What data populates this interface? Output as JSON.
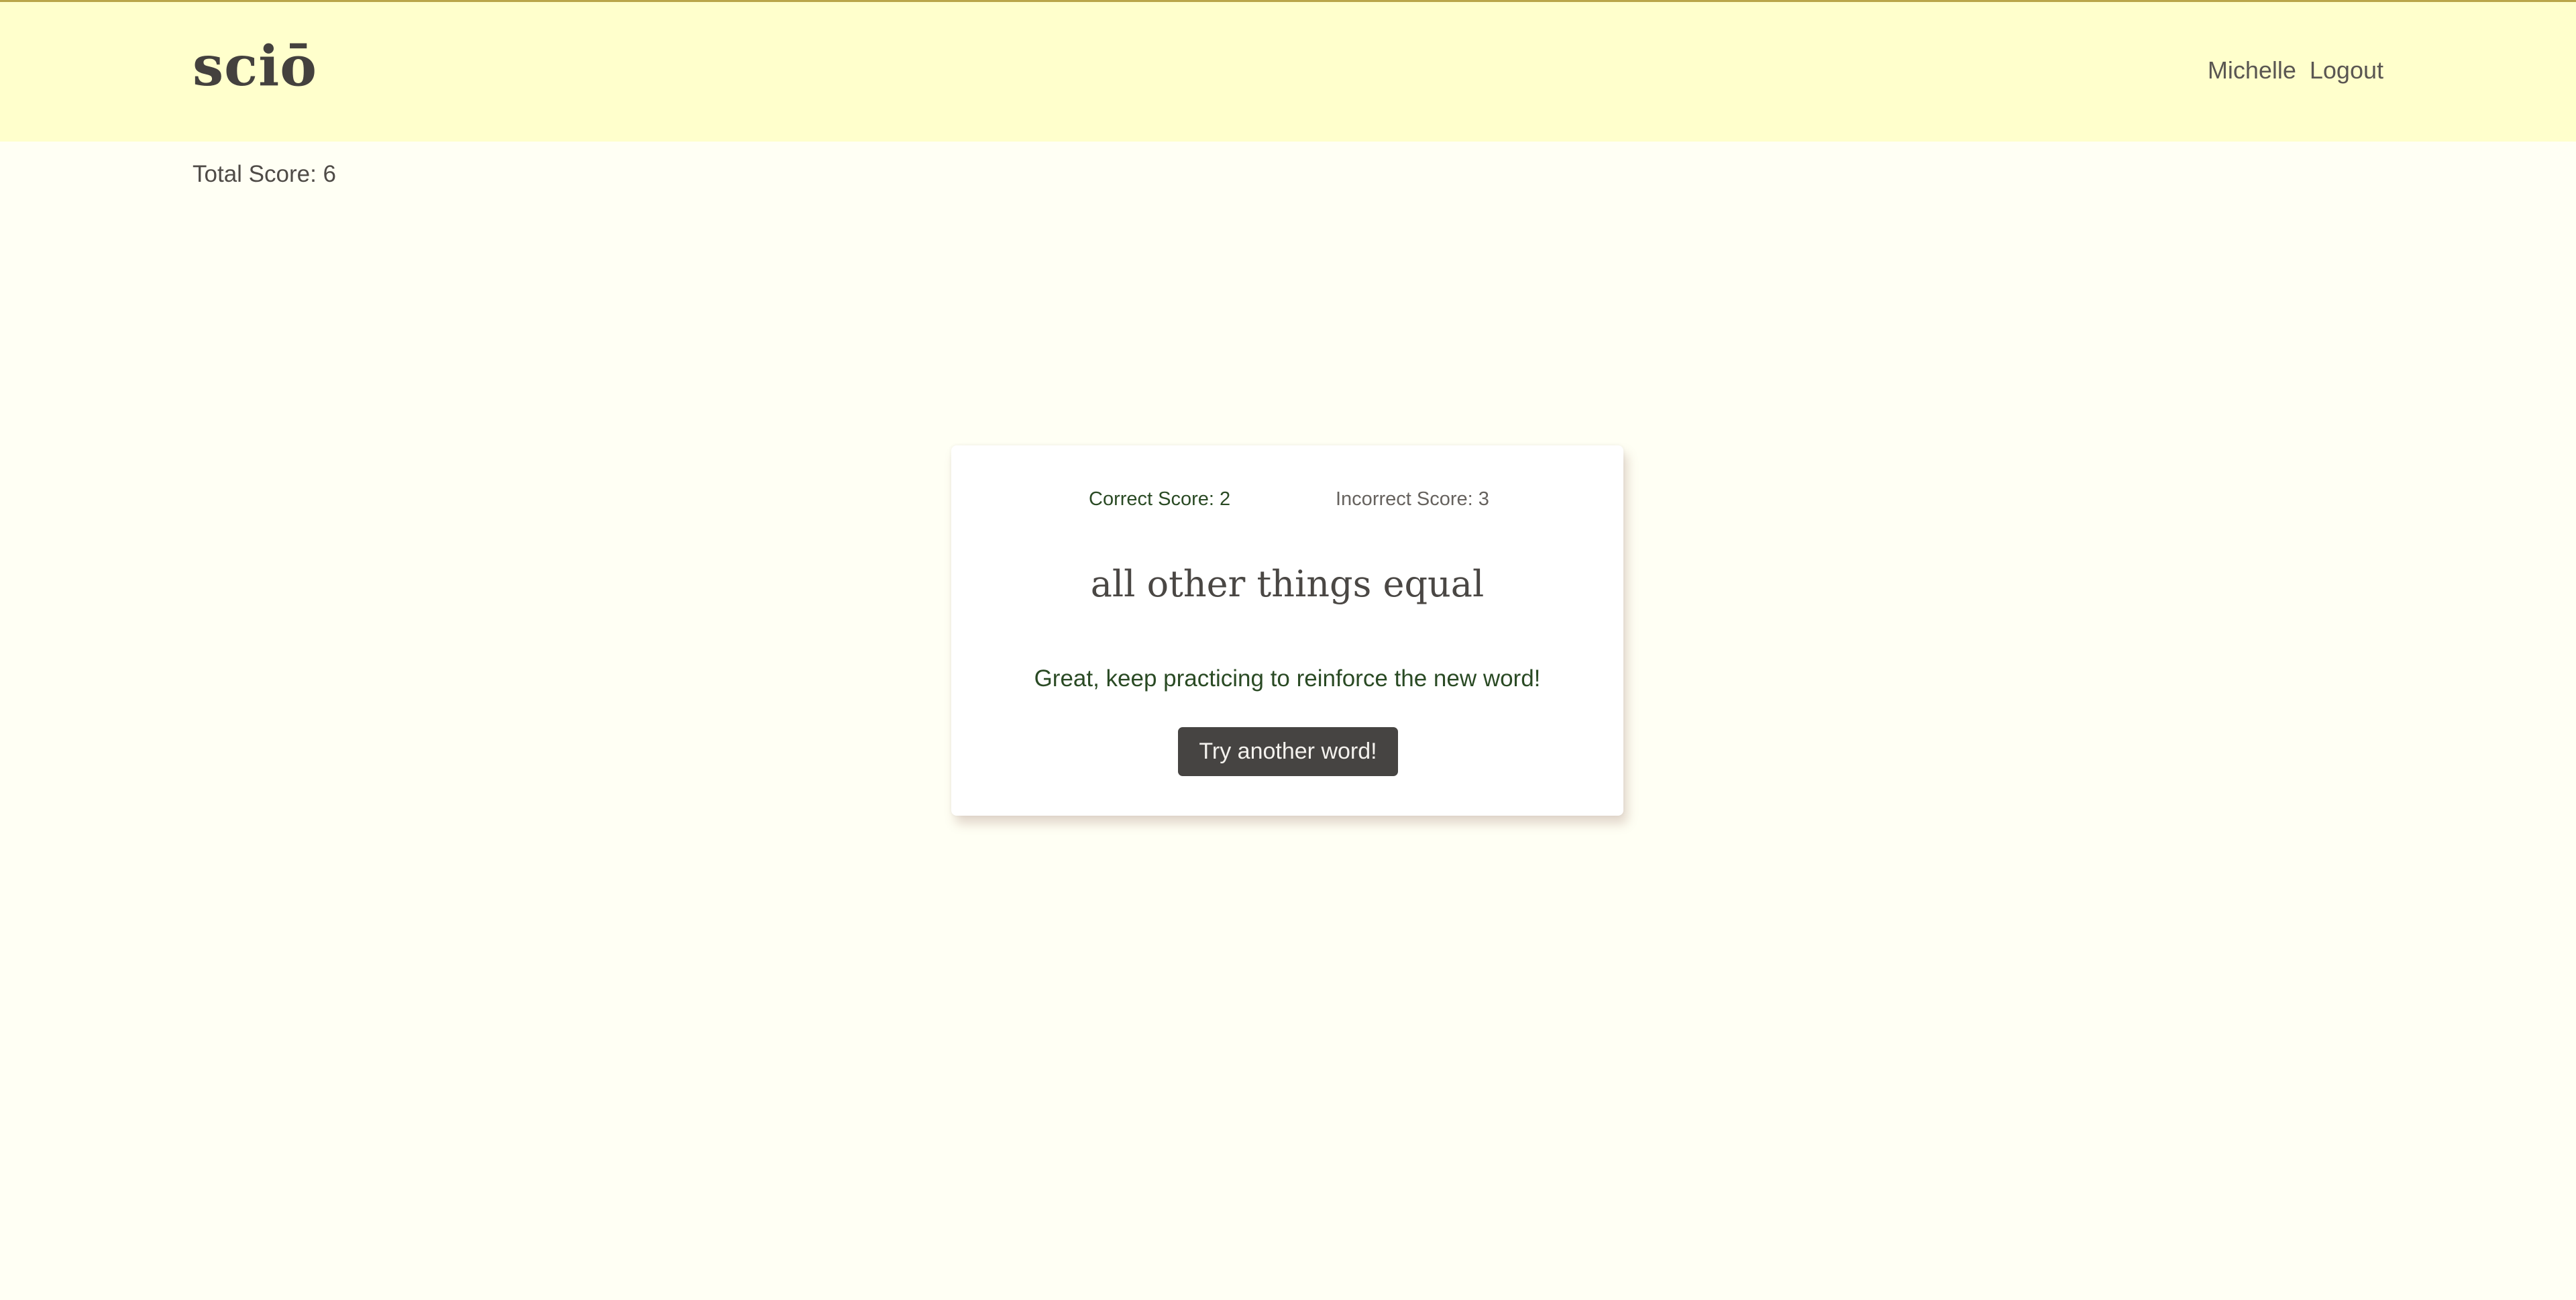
{
  "header": {
    "logo": "sciō",
    "nav": {
      "user": "Michelle",
      "logout": "Logout"
    }
  },
  "total_score": "Total Score: 6",
  "card": {
    "correct_score": "Correct Score: 2",
    "incorrect_score": "Incorrect Score: 3",
    "word": "all other things equal",
    "feedback": "Great, keep practicing to reinforce the new word!",
    "button_label": "Try another word!"
  },
  "colors": {
    "header_bg": "#ffffcc",
    "page_bg": "#fffff4",
    "success_text": "#2a4a24",
    "button_bg": "#464442"
  }
}
